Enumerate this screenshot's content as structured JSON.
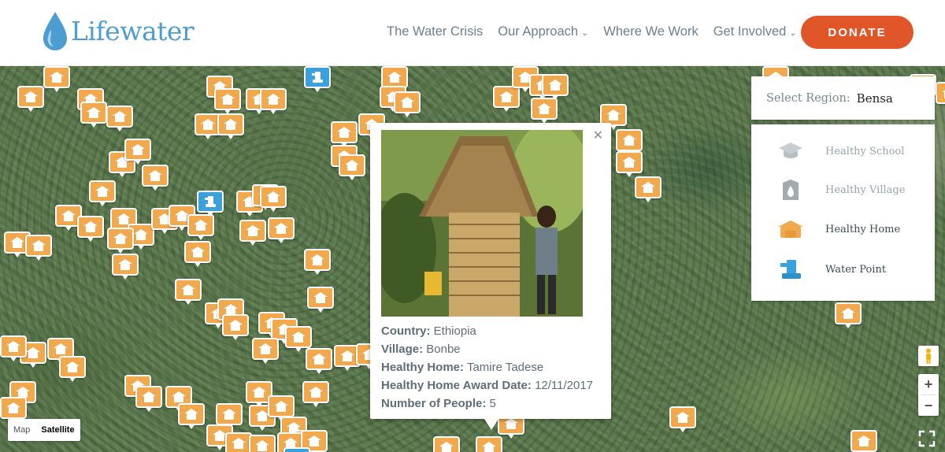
{
  "brand": {
    "name": "Lifewater",
    "logo_color": "#4e9dd0"
  },
  "nav": {
    "items": [
      {
        "label": "The Water Crisis",
        "dropdown": false
      },
      {
        "label": "Our Approach",
        "dropdown": true
      },
      {
        "label": "Where We Work",
        "dropdown": false
      },
      {
        "label": "Get Involved",
        "dropdown": true
      }
    ],
    "donate_label": "DONATE",
    "donate_color": "#e05628"
  },
  "region": {
    "label": "Select Region:",
    "value": "Bensa"
  },
  "legend": {
    "items": [
      {
        "label": "Healthy School",
        "icon": "graduation-cap-icon",
        "active": false
      },
      {
        "label": "Healthy Village",
        "icon": "water-drop-icon",
        "active": false
      },
      {
        "label": "Healthy Home",
        "icon": "home-icon",
        "active": true
      },
      {
        "label": "Water Point",
        "icon": "water-point-icon",
        "active": true
      }
    ]
  },
  "info": {
    "rows": [
      {
        "key": "Country:",
        "value": "Ethiopia"
      },
      {
        "key": "Village:",
        "value": "Bonbe"
      },
      {
        "key": "Healthy Home:",
        "value": "Tamire Tadese"
      },
      {
        "key": "Healthy Home Award Date:",
        "value": "12/11/2017"
      },
      {
        "key": "Number of People:",
        "value": "5"
      }
    ]
  },
  "map_controls": {
    "map_label": "Map",
    "satellite_label": "Satellite",
    "zoom_in": "+",
    "zoom_out": "−"
  },
  "colors": {
    "marker_home": "#f2a94d",
    "marker_water": "#3aa1dd"
  }
}
